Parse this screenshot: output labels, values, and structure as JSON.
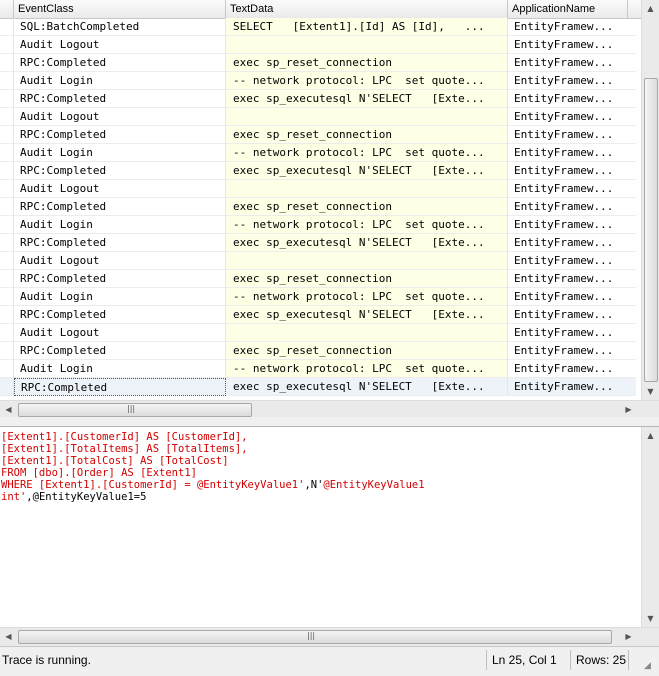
{
  "columns": [
    "EventClass",
    "TextData",
    "ApplicationName"
  ],
  "rows": [
    {
      "event": "SQL:BatchCompleted",
      "text": "SELECT   [Extent1].[Id] AS [Id],   ...",
      "app": "EntityFramew..."
    },
    {
      "event": "Audit Logout",
      "text": "",
      "app": "EntityFramew..."
    },
    {
      "event": "RPC:Completed",
      "text": "exec sp_reset_connection",
      "app": "EntityFramew..."
    },
    {
      "event": "Audit Login",
      "text": "-- network protocol: LPC  set quote...",
      "app": "EntityFramew..."
    },
    {
      "event": "RPC:Completed",
      "text": "exec sp_executesql N'SELECT   [Exte...",
      "app": "EntityFramew..."
    },
    {
      "event": "Audit Logout",
      "text": "",
      "app": "EntityFramew..."
    },
    {
      "event": "RPC:Completed",
      "text": "exec sp_reset_connection",
      "app": "EntityFramew..."
    },
    {
      "event": "Audit Login",
      "text": "-- network protocol: LPC  set quote...",
      "app": "EntityFramew..."
    },
    {
      "event": "RPC:Completed",
      "text": "exec sp_executesql N'SELECT   [Exte...",
      "app": "EntityFramew..."
    },
    {
      "event": "Audit Logout",
      "text": "",
      "app": "EntityFramew..."
    },
    {
      "event": "RPC:Completed",
      "text": "exec sp_reset_connection",
      "app": "EntityFramew..."
    },
    {
      "event": "Audit Login",
      "text": "-- network protocol: LPC  set quote...",
      "app": "EntityFramew..."
    },
    {
      "event": "RPC:Completed",
      "text": "exec sp_executesql N'SELECT   [Exte...",
      "app": "EntityFramew..."
    },
    {
      "event": "Audit Logout",
      "text": "",
      "app": "EntityFramew..."
    },
    {
      "event": "RPC:Completed",
      "text": "exec sp_reset_connection",
      "app": "EntityFramew..."
    },
    {
      "event": "Audit Login",
      "text": "-- network protocol: LPC  set quote...",
      "app": "EntityFramew..."
    },
    {
      "event": "RPC:Completed",
      "text": "exec sp_executesql N'SELECT   [Exte...",
      "app": "EntityFramew..."
    },
    {
      "event": "Audit Logout",
      "text": "",
      "app": "EntityFramew..."
    },
    {
      "event": "RPC:Completed",
      "text": "exec sp_reset_connection",
      "app": "EntityFramew..."
    },
    {
      "event": "Audit Login",
      "text": "-- network protocol: LPC  set quote...",
      "app": "EntityFramew..."
    },
    {
      "event": "RPC:Completed",
      "text": "exec sp_executesql N'SELECT   [Exte...",
      "app": "EntityFramew..."
    }
  ],
  "selected_row": 20,
  "detail_lines": [
    [
      {
        "t": "[Extent1].[CustomerId] AS [CustomerId],",
        "c": "r"
      }
    ],
    [
      {
        "t": "[Extent1].[TotalItems] AS [TotalItems],",
        "c": "r"
      }
    ],
    [
      {
        "t": "[Extent1].[TotalCost] AS [TotalCost]",
        "c": "r"
      }
    ],
    [
      {
        "t": "FROM [dbo].[Order] AS [Extent1]",
        "c": "r"
      }
    ],
    [
      {
        "t": "WHERE [Extent1].[CustomerId] = @EntityKeyValue1'",
        "c": "r"
      },
      {
        "t": ",N'",
        "c": "k"
      },
      {
        "t": "@EntityKeyValue1",
        "c": "r"
      }
    ],
    [
      {
        "t": "int'",
        "c": "r"
      },
      {
        "t": ",@EntityKeyValue1=5",
        "c": "k"
      }
    ]
  ],
  "status": {
    "message": "Trace is running.",
    "position": "Ln 25, Col 1",
    "rows": "Rows: 25"
  },
  "icons": {
    "up": "up-arrow-icon",
    "down": "down-arrow-icon",
    "left": "left-arrow-icon",
    "right": "right-arrow-icon",
    "grip": "grip-icon"
  }
}
